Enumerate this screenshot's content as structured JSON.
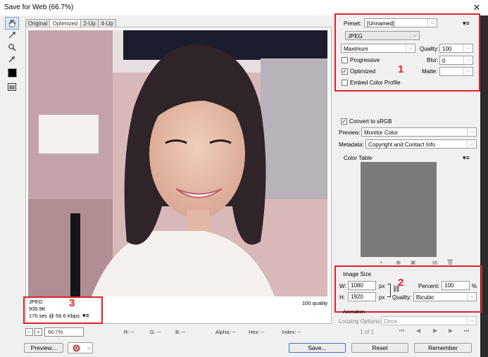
{
  "window": {
    "title": "Save for Web (66.7%)",
    "close": "✕"
  },
  "view_tabs": [
    "Original",
    "Optimized",
    "2-Up",
    "4-Up"
  ],
  "preview_info": {
    "format": "JPEG",
    "size": "935.9K",
    "time": "170 sec @ 56.6 Kbps",
    "quality_note": "100 quality"
  },
  "settings": {
    "preset_label": "Preset:",
    "preset_value": "[Unnamed]",
    "format_value": "JPEG",
    "compression_value": "Maximum",
    "quality_label": "Quality:",
    "quality_value": "100",
    "progressive_label": "Progressive",
    "blur_label": "Blur:",
    "blur_value": "0",
    "optimized_label": "Optimized",
    "matte_label": "Matte:",
    "embed_label": "Embed Color Profile",
    "convert_label": "Convert to sRGB",
    "preview_label": "Preview:",
    "preview_value": "Monitor Color",
    "metadata_label": "Metadata:",
    "metadata_value": "Copyright and Contact Info",
    "color_table_label": "Color Table"
  },
  "image_size": {
    "title": "Image Size",
    "w_label": "W:",
    "w_value": "1080",
    "h_label": "H:",
    "h_value": "1920",
    "unit": "px",
    "percent_label": "Percent:",
    "percent_value": "100",
    "percent_unit": "%",
    "quality_label": "Quality:",
    "quality_value": "Bicubic"
  },
  "animation": {
    "title": "Animation",
    "looping_label": "Looping Options:",
    "looping_value": "Once",
    "frame_counter": "1 of 1"
  },
  "status_bar": {
    "zoom_value": "66.7%",
    "r": "R: --",
    "g": "G: --",
    "b": "B: --",
    "alpha": "Alpha: --",
    "hex": "Hex: --",
    "index": "Index: --"
  },
  "buttons": {
    "preview": "Preview...",
    "save": "Save...",
    "reset": "Reset",
    "remember": "Remember"
  },
  "annotations": [
    "1",
    "2",
    "3"
  ],
  "colors": {
    "highlight": "#e0202a",
    "color_table": "#7b7b7b"
  }
}
